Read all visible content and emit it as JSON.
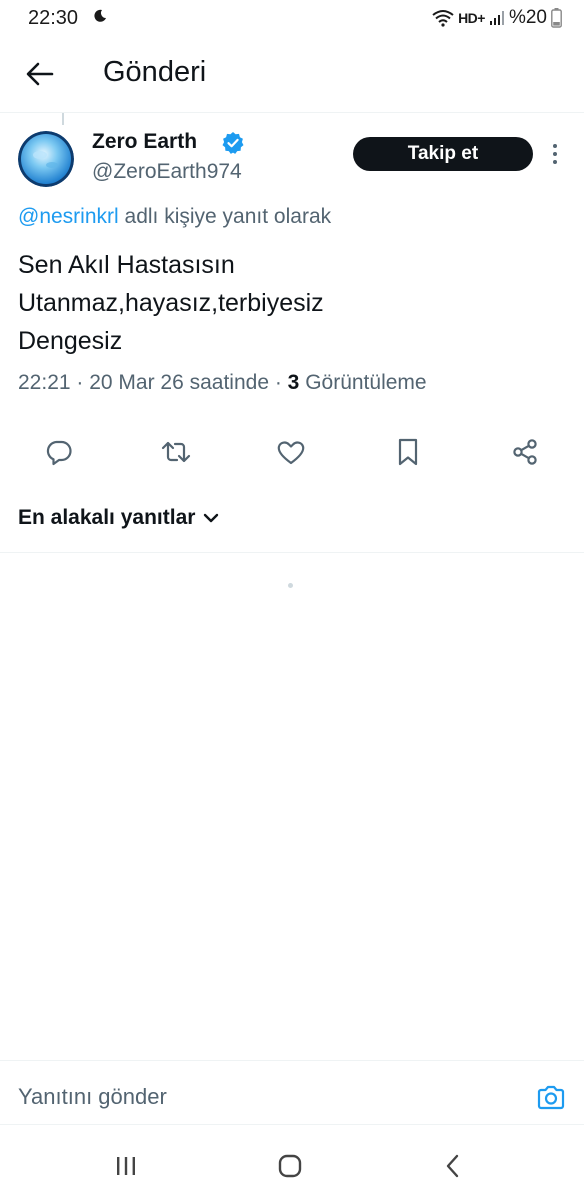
{
  "status_bar": {
    "time": "22:30",
    "network": "HD+",
    "battery": "%20",
    "icons": [
      "moon-icon",
      "wifi-icon",
      "signal-icon",
      "battery-icon"
    ]
  },
  "header": {
    "title": "Gönderi",
    "back_icon": "arrow-left-icon"
  },
  "post": {
    "author_name": "Zero Earth",
    "author_handle": "@ZeroEarth974",
    "follow_label": "Takip et",
    "reply_mention": "@nesrinkrl",
    "reply_suffix": " adlı kişiye yanıt olarak",
    "lines": [
      "Sen Akıl Hastasısın",
      "Utanmaz,hayasız,terbiyesiz",
      "Dengesiz"
    ],
    "meta_time": "22:21 · 20 Mar 26 saatinde · ",
    "views_count": "3",
    "views_label": " Görüntüleme",
    "actions": [
      "reply-icon",
      "retweet-icon",
      "like-icon",
      "bookmark-icon",
      "share-icon"
    ]
  },
  "replies": {
    "sort_label": "En alakalı yanıtlar"
  },
  "composer": {
    "placeholder": "Yanıtını gönder"
  },
  "colors": {
    "accent": "#1d9bf0",
    "text": "#0f1419",
    "secondary": "#536471",
    "button": "#0f1419"
  }
}
